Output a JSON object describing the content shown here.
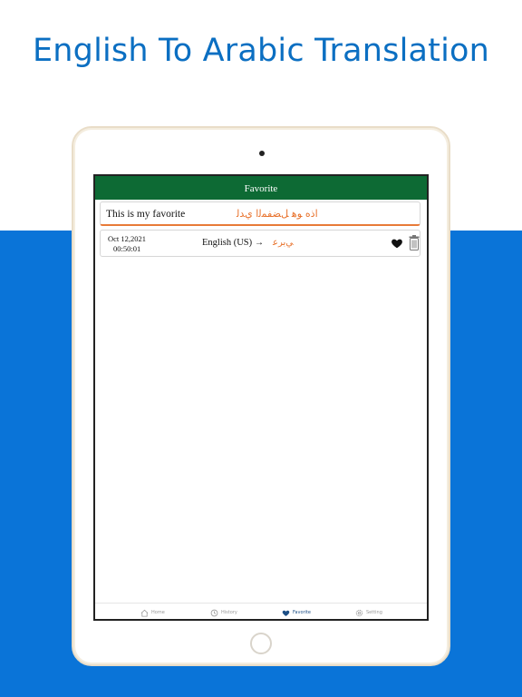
{
  "headline": "English To Arabic Translation",
  "screen": {
    "nav_title": "Favorite",
    "input": {
      "source_text": "This is my favorite",
      "translated_text": "ﺍﺫﻩ ﻮﻫ ﻞﻀﻔﻤﻟﺍ ﻱﺪﻟ"
    },
    "history_item": {
      "date": "Oct 12,2021",
      "time": "00:50:01",
      "source_lang": "English (US)",
      "arrow": "→",
      "target_lang": "ﻲﺑﺮﻋ"
    },
    "tabs": [
      {
        "label": "Home",
        "icon": "home-icon"
      },
      {
        "label": "History",
        "icon": "history-icon"
      },
      {
        "label": "Favorite",
        "icon": "heart-icon"
      },
      {
        "label": "Setting",
        "icon": "gear-icon"
      }
    ]
  },
  "colors": {
    "band_blue": "#0a74d8",
    "headline_blue": "#0b6fc2",
    "nav_green": "#0d6a34",
    "accent_orange": "#e87a38"
  }
}
